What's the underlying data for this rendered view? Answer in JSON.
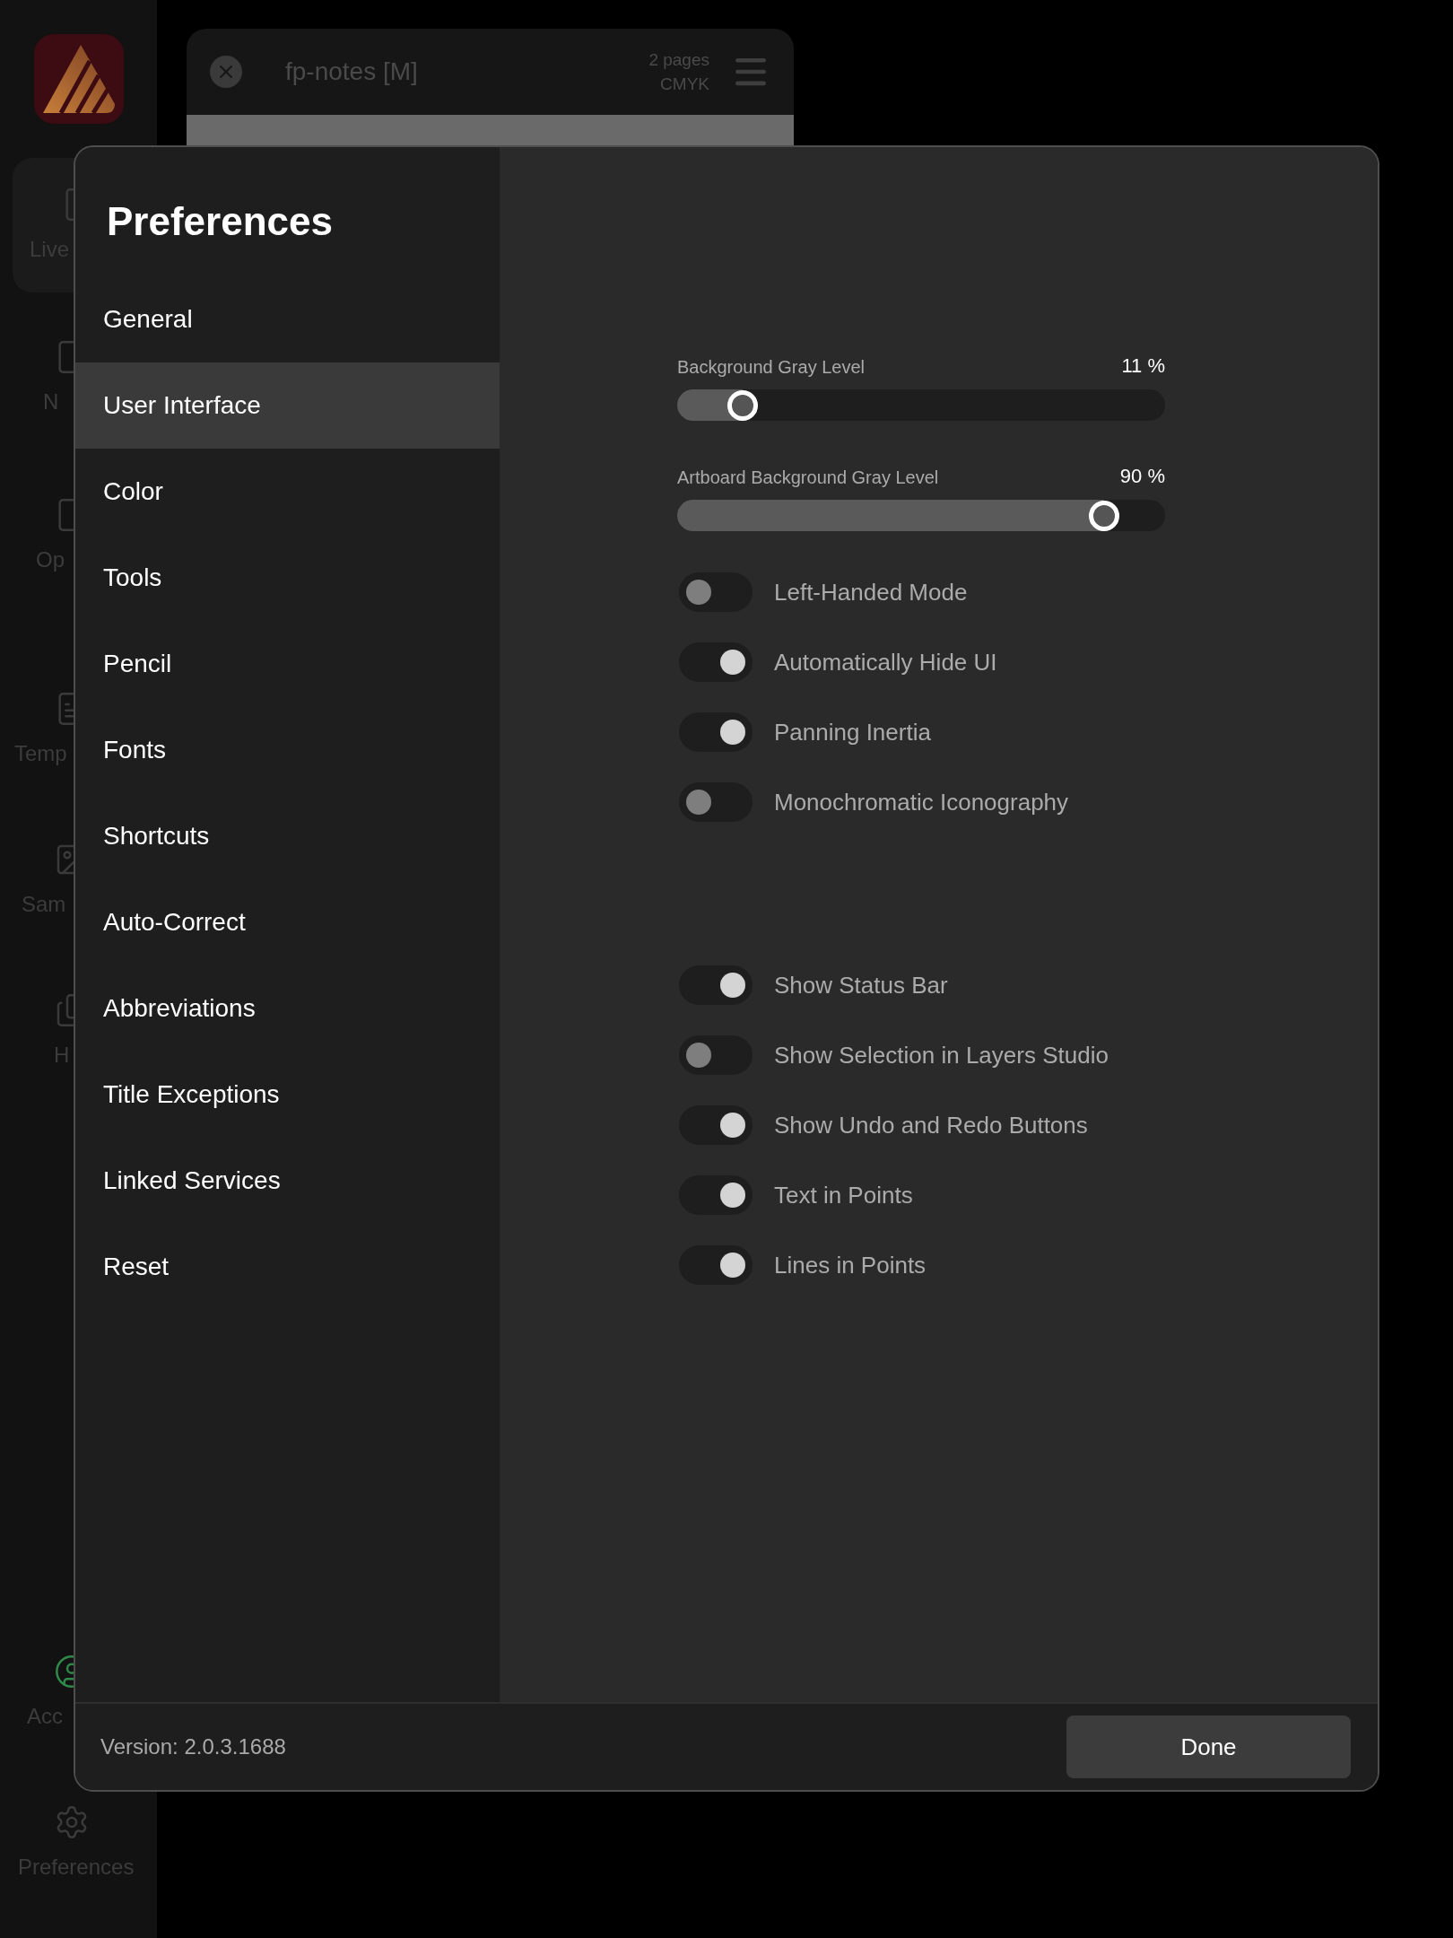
{
  "app_sidebar": {
    "items": [
      {
        "label": "Live",
        "selected": true
      },
      {
        "label": "N",
        "selected": false
      },
      {
        "label": "Op",
        "selected": false
      },
      {
        "label": "Temp",
        "selected": false
      },
      {
        "label": "Sam",
        "selected": false
      },
      {
        "label": "H",
        "selected": false
      },
      {
        "label": "Acc",
        "selected": false
      },
      {
        "label": "Preferences",
        "selected": false
      }
    ]
  },
  "document": {
    "title": "fp-notes [M]",
    "info": [
      "2 pages",
      "CMYK"
    ]
  },
  "preferences": {
    "title": "Preferences",
    "menu": [
      {
        "label": "General",
        "selected": false
      },
      {
        "label": "User Interface",
        "selected": true
      },
      {
        "label": "Color",
        "selected": false
      },
      {
        "label": "Tools",
        "selected": false
      },
      {
        "label": "Pencil",
        "selected": false
      },
      {
        "label": "Fonts",
        "selected": false
      },
      {
        "label": "Shortcuts",
        "selected": false
      },
      {
        "label": "Auto-Correct",
        "selected": false
      },
      {
        "label": "Abbreviations",
        "selected": false
      },
      {
        "label": "Title Exceptions",
        "selected": false
      },
      {
        "label": "Linked Services",
        "selected": false
      },
      {
        "label": "Reset",
        "selected": false
      }
    ],
    "sliders": [
      {
        "label": "Background Gray Level",
        "reading": "11 %",
        "level": 0.11
      },
      {
        "label": "Artboard Background Gray Level",
        "reading": "90 %",
        "level": 0.9
      }
    ],
    "toggle_groups": [
      [
        {
          "label": "Left-Handed Mode",
          "on": false
        },
        {
          "label": "Automatically Hide UI",
          "on": true
        },
        {
          "label": "Panning Inertia",
          "on": true
        },
        {
          "label": "Monochromatic Iconography",
          "on": false
        }
      ],
      [
        {
          "label": "Show Status Bar",
          "on": true
        },
        {
          "label": "Show Selection in Layers Studio",
          "on": false
        },
        {
          "label": "Show Undo and Redo Buttons",
          "on": true
        },
        {
          "label": "Text in Points",
          "on": true
        },
        {
          "label": "Lines in Points",
          "on": true
        }
      ]
    ],
    "version": "Version: 2.0.3.1688",
    "done_button": "Done"
  }
}
